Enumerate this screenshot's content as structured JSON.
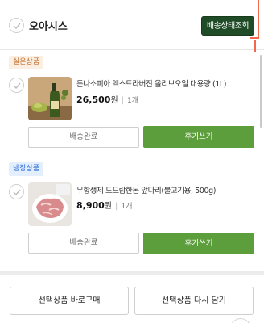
{
  "store": {
    "name": "오아시스",
    "track_button_label": "배송상태조회"
  },
  "items": [
    {
      "category_badge": "실온상품",
      "name": "돈나소피아 엑스트라버진 올리브오일 대용량 (1L)",
      "price": "26,500",
      "currency": "원",
      "quantity": "1개",
      "status_button": "배송완료",
      "review_button": "후기쓰기"
    },
    {
      "category_badge": "냉장상품",
      "name": "무항생제 도드람한돈 앞다리(불고기용, 500g)",
      "price": "8,900",
      "currency": "원",
      "quantity": "1개",
      "status_button": "배송완료",
      "review_button": "후기쓰기"
    }
  ],
  "bottom_actions": {
    "buy_selected": "선택상품 바로구매",
    "add_to_cart_again": "선택상품 다시 담기"
  },
  "colors": {
    "accent_green": "#5c9d3c",
    "dark_green": "#1f4b26",
    "highlight_orange": "#f26a4b"
  }
}
